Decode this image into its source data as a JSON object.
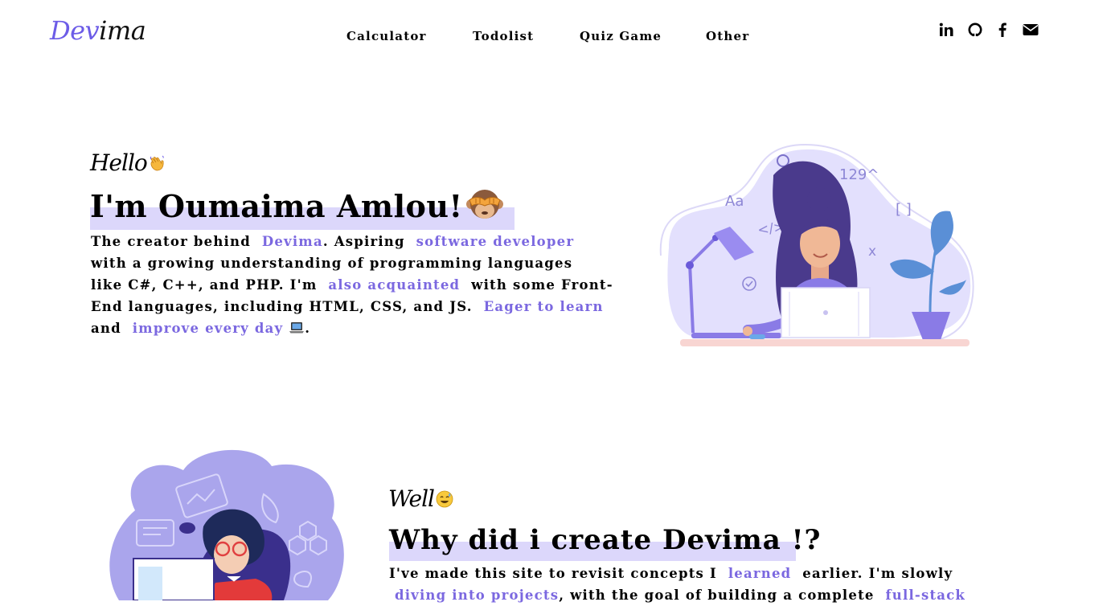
{
  "header": {
    "logo_part1": "Dev",
    "logo_part2": "ima",
    "nav": [
      {
        "label": "Calculator"
      },
      {
        "label": "Todolist"
      },
      {
        "label": "Quiz Game"
      },
      {
        "label": "Other"
      }
    ],
    "social": [
      "linkedin-icon",
      "github-icon",
      "facebook-icon",
      "envelope-icon"
    ]
  },
  "hero": {
    "greeting": "Hello",
    "title": "I'm Oumaima Amlou!",
    "para": {
      "t1": "The creator behind",
      "h1": "Devima",
      "t2": ". Aspiring",
      "h2": "software developer",
      "l2": "with a growing understanding of programming languages",
      "l3a": "like C#, C++, and PHP. I'm",
      "h3": "also acquainted",
      "l3b": "with some Front-",
      "l4a": "End languages, including HTML, CSS, and JS.",
      "h4": "Eager to learn",
      "l5a": "and",
      "h5": "improve every day",
      "l5b": "."
    },
    "illustration": {
      "magnifier_label": "129^",
      "aa_label": "Aa",
      "code_label": "</>",
      "brackets_label": "[ ]",
      "x_label": "x"
    }
  },
  "why": {
    "greeting": "Well",
    "title": "Why did i create Devima !?",
    "para": {
      "l1a": "I've made this site to revisit concepts I",
      "h1": "learned",
      "l1b": "earlier. I'm slowly",
      "h2": "diving into projects",
      "l2a": ", with the goal of building a complete",
      "h3": "full-stack"
    }
  },
  "colors": {
    "accent": "#7b68e0",
    "highlight": "#dcd7fb",
    "blob": "#e3e0fd"
  }
}
